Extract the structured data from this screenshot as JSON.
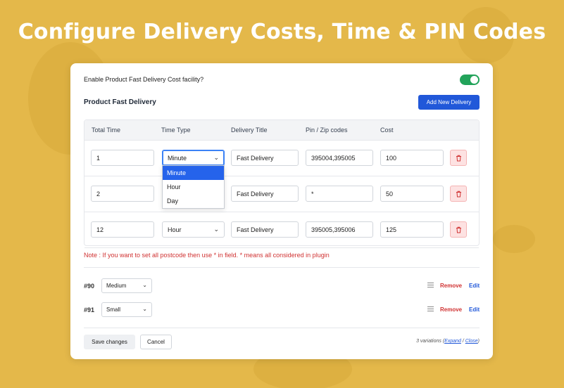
{
  "headline": "Configure Delivery Costs, Time & PIN Codes",
  "settings": {
    "enable_label": "Enable Product Fast Delivery Cost facility?",
    "enable_on": true,
    "section_title": "Product Fast Delivery",
    "add_button": "Add New Delivery"
  },
  "table": {
    "headers": {
      "total_time": "Total Time",
      "time_type": "Time Type",
      "delivery_title": "Delivery Title",
      "pin_codes": "Pin / Zip codes",
      "cost": "Cost"
    },
    "rows": [
      {
        "total_time": "1",
        "time_type": "Minute",
        "title": "Fast Delivery",
        "pins": "395004,395005",
        "cost": "100"
      },
      {
        "total_time": "2",
        "time_type": "",
        "title": "Fast Delivery",
        "pins": "*",
        "cost": "50"
      },
      {
        "total_time": "12",
        "time_type": "Hour",
        "title": "Fast Delivery",
        "pins": "395005,395006",
        "cost": "125"
      }
    ],
    "dropdown_options": [
      "Minute",
      "Hour",
      "Day"
    ],
    "dropdown_selected": "Minute"
  },
  "note": "Note : If you want to set all postcode then use * in field. * means all considered in plugin",
  "variations": [
    {
      "id": "#90",
      "size": "Medium",
      "remove": "Remove",
      "edit": "Edit"
    },
    {
      "id": "#91",
      "size": "Small",
      "remove": "Remove",
      "edit": "Edit"
    }
  ],
  "footer": {
    "save": "Save changes",
    "cancel": "Cancel",
    "count_text": "3 variations (",
    "expand": "Expand",
    "sep": " / ",
    "close": "Close",
    "close_paren": ")"
  },
  "colors": {
    "background": "#e4b84a",
    "primary": "#2158d9",
    "toggle_on": "#22a35a",
    "danger": "#d03232"
  }
}
